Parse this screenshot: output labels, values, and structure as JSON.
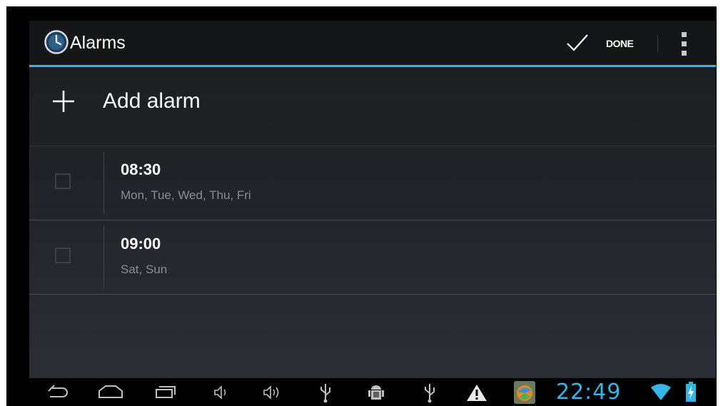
{
  "action_bar": {
    "title": "Alarms",
    "app_icon": "clock-icon",
    "done_icon": "check-icon",
    "done_label": "DONE",
    "overflow_icon": "overflow-menu-icon",
    "accent_color": "#33b5e5"
  },
  "add_alarm": {
    "icon": "plus-icon",
    "label": "Add alarm"
  },
  "alarms": [
    {
      "time": "08:30",
      "days": "Mon, Tue, Wed, Thu, Fri",
      "enabled": false
    },
    {
      "time": "09:00",
      "days": "Sat, Sun",
      "enabled": false
    }
  ],
  "nav_bar": {
    "buttons": [
      "back-icon",
      "home-icon",
      "recent-apps-icon",
      "volume-down-icon",
      "volume-up-icon"
    ],
    "notifications": [
      "usb-icon",
      "android-debug-icon",
      "usb-icon",
      "warning-icon",
      "app-notification-icon"
    ],
    "clock": "22:49",
    "status_icons": [
      "wifi-icon",
      "battery-charging-icon"
    ],
    "clock_color": "#33b5e5"
  }
}
